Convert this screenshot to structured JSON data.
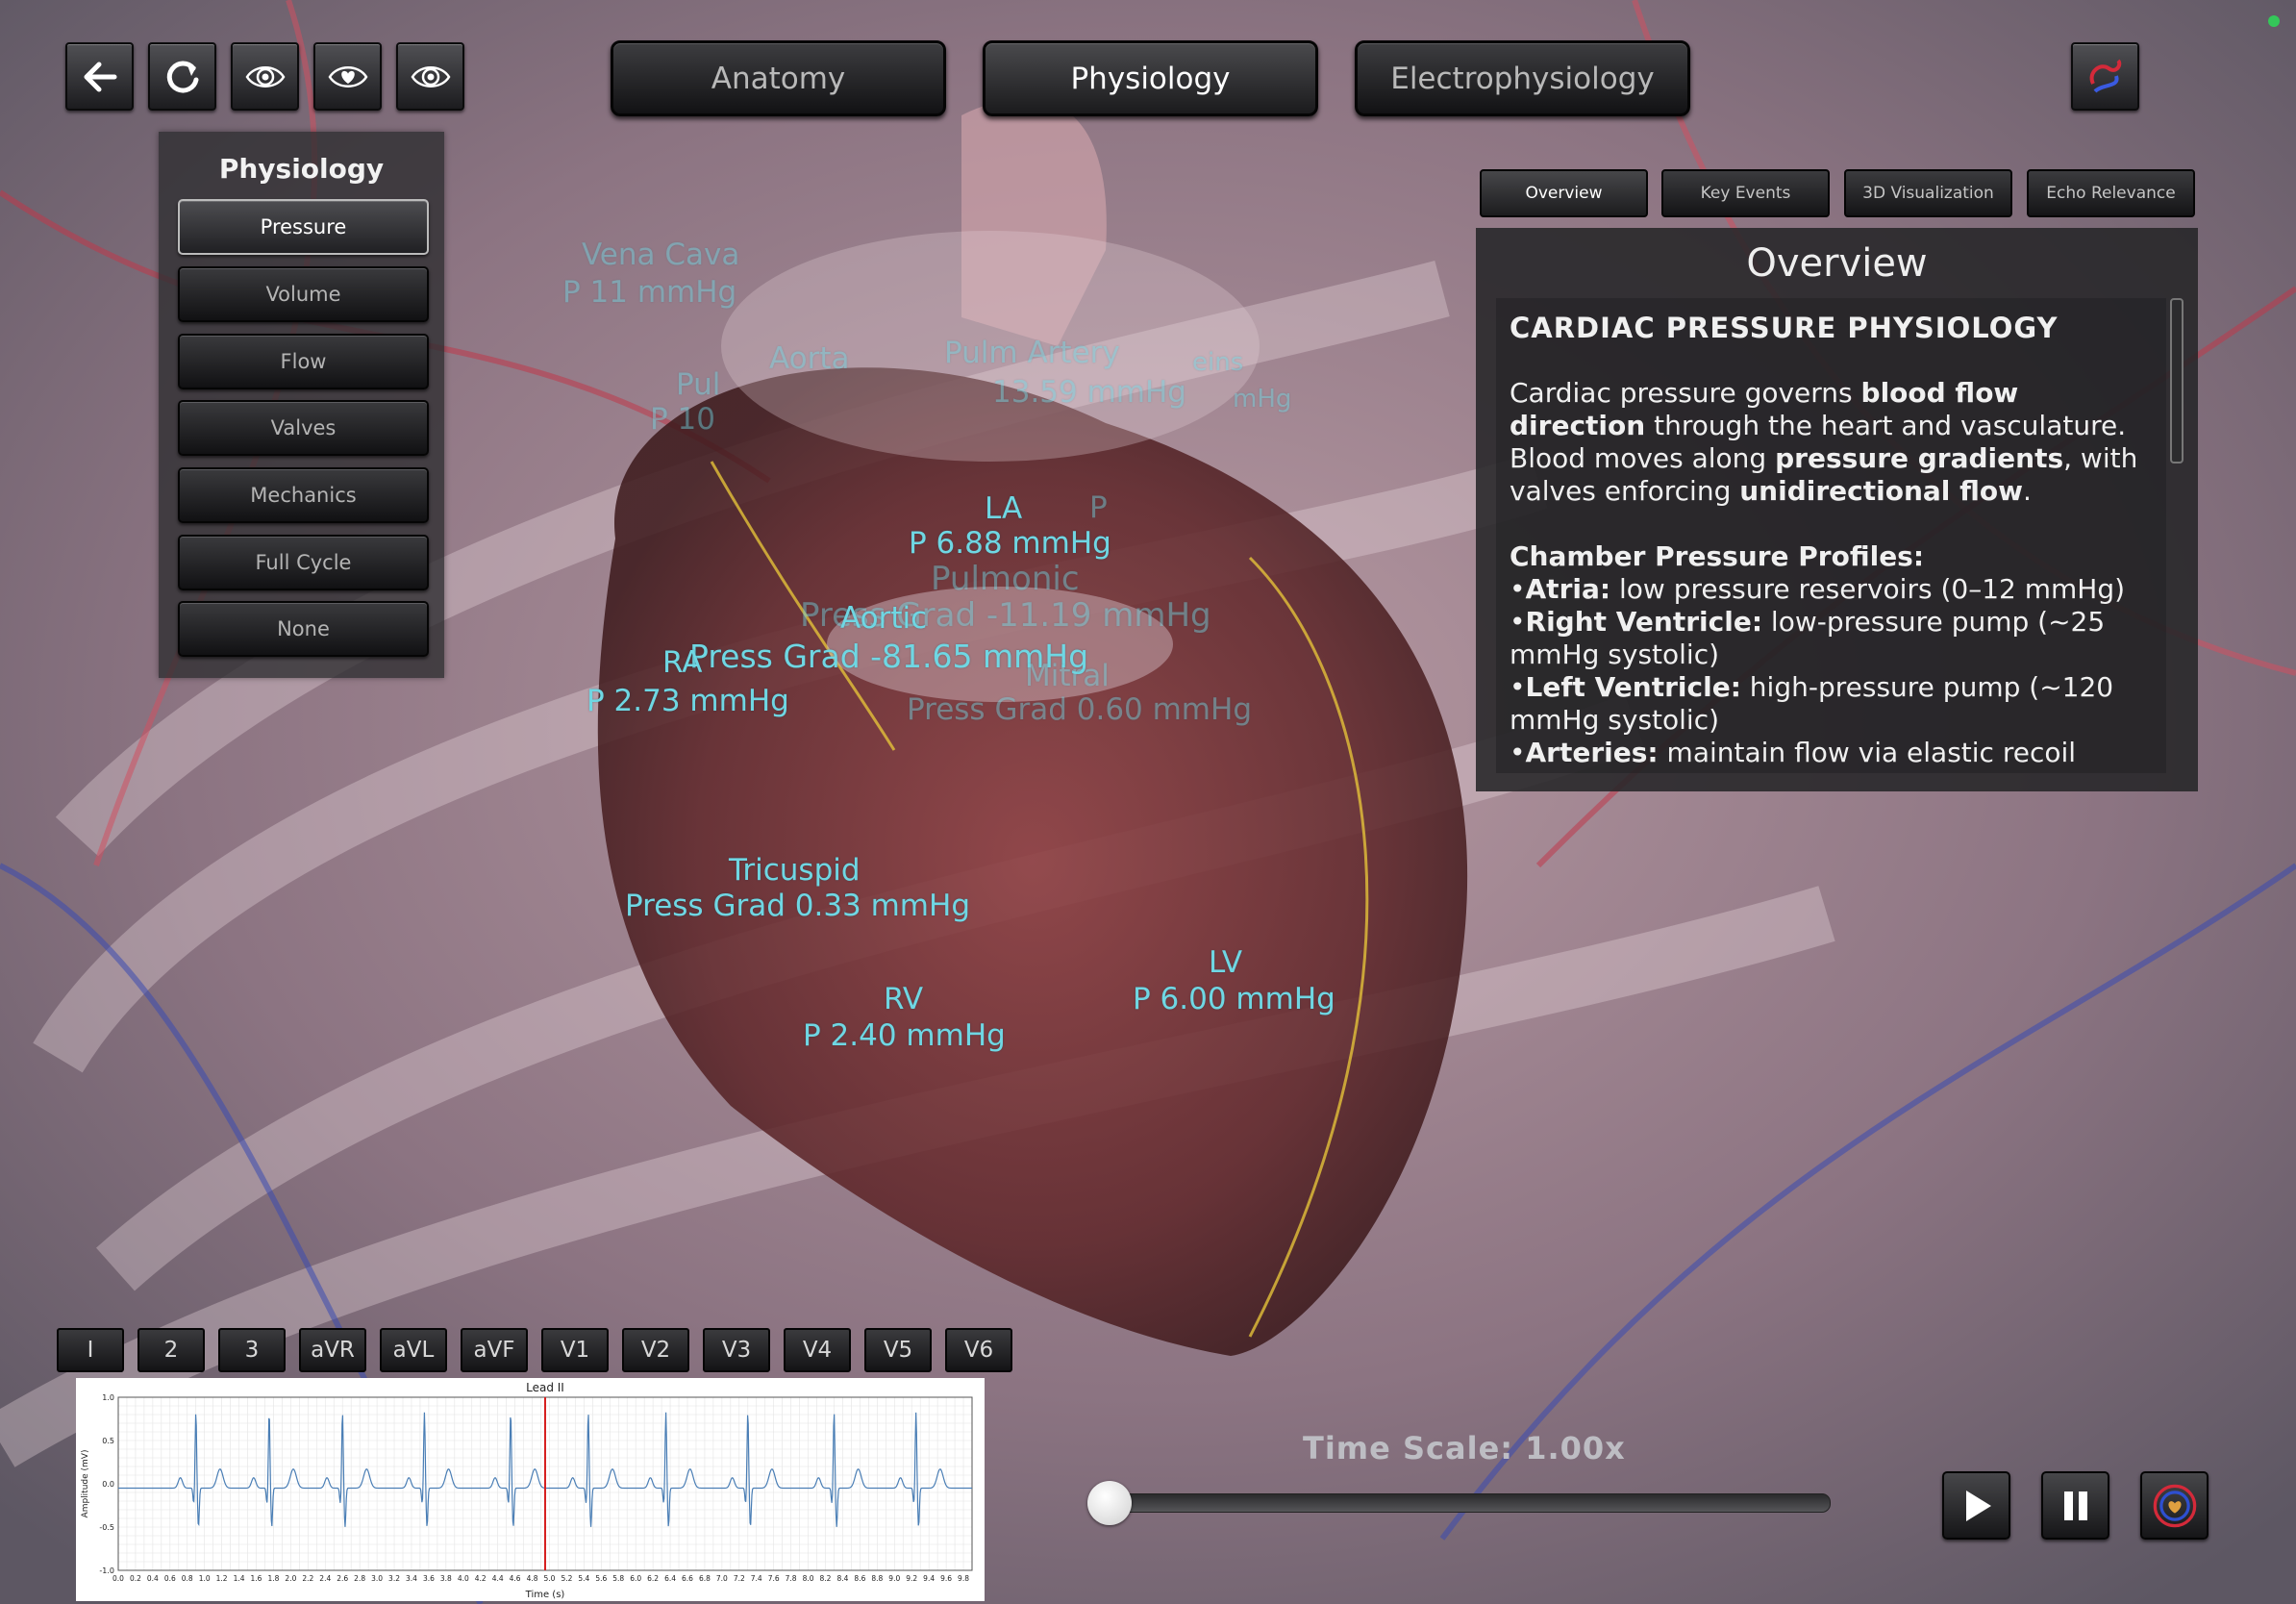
{
  "toolbar": {
    "icons": [
      "back-arrow-icon",
      "reload-icon",
      "eye-icon",
      "eye-heart-icon",
      "eye-icon"
    ]
  },
  "main_tabs": [
    {
      "label": "Anatomy",
      "active": false
    },
    {
      "label": "Physiology",
      "active": true
    },
    {
      "label": "Electrophysiology",
      "active": false
    }
  ],
  "sidebar": {
    "title": "Physiology",
    "items": [
      {
        "label": "Pressure",
        "active": true
      },
      {
        "label": "Volume",
        "active": false
      },
      {
        "label": "Flow",
        "active": false
      },
      {
        "label": "Valves",
        "active": false
      },
      {
        "label": "Mechanics",
        "active": false
      },
      {
        "label": "Full Cycle",
        "active": false
      },
      {
        "label": "None",
        "active": false
      }
    ]
  },
  "sub_tabs": [
    {
      "label": "Overview",
      "active": true
    },
    {
      "label": "Key Events",
      "active": false
    },
    {
      "label": "3D Visualization",
      "active": false
    },
    {
      "label": "Echo Relevance",
      "active": false
    }
  ],
  "overview": {
    "title": "Overview",
    "heading": "CARDIAC PRESSURE PHYSIOLOGY",
    "para": {
      "t1": "Cardiac pressure governs ",
      "b1": "blood flow direction",
      "t2": " through the heart and vasculature. Blood moves along ",
      "b2": "pressure gradients",
      "t3": ", with valves enforcing ",
      "b3": "unidirectional flow",
      "t4": "."
    },
    "profiles_title": "Chamber Pressure Profiles:",
    "profiles": [
      {
        "term": "Atria:",
        "text": " low pressure reservoirs (0–12 mmHg)"
      },
      {
        "term": "Right Ventricle:",
        "text": " low-pressure pump (~25 mmHg systolic)"
      },
      {
        "term": "Left Ventricle:",
        "text": " high-pressure pump (~120 mmHg systolic)"
      },
      {
        "term": "Arteries:",
        "text": " maintain flow via elastic recoil"
      }
    ],
    "bullet": "•"
  },
  "leads": [
    "I",
    "2",
    "3",
    "aVR",
    "aVL",
    "aVF",
    "V1",
    "V2",
    "V3",
    "V4",
    "V5",
    "V6"
  ],
  "ecg": {
    "title": "Lead II",
    "ylabel": "Amplitude (mV)",
    "xlabel": "Time (s)",
    "y_ticks": [
      "1.0",
      "0.5",
      "0.0",
      "-0.5",
      "-1.0"
    ],
    "x_ticks": [
      "0.0",
      "0.2",
      "0.4",
      "0.6",
      "0.8",
      "1.0",
      "1.2",
      "1.4",
      "1.6",
      "1.8",
      "2.0",
      "2.2",
      "2.4",
      "2.6",
      "2.8",
      "3.0",
      "3.2",
      "3.4",
      "3.6",
      "3.8",
      "4.0",
      "4.2",
      "4.4",
      "4.6",
      "4.8",
      "5.0",
      "5.2",
      "5.4",
      "5.6",
      "5.8",
      "6.0",
      "6.2",
      "6.4",
      "6.6",
      "6.8",
      "7.0",
      "7.2",
      "7.4",
      "7.6",
      "7.8",
      "8.0",
      "8.2",
      "8.4",
      "8.6",
      "8.8",
      "9.0",
      "9.2",
      "9.4",
      "9.6",
      "9.8"
    ],
    "xlim": [
      0,
      9.9
    ],
    "ylim": [
      -1.0,
      1.0
    ],
    "cursor_time": 4.95,
    "beat_times": [
      0.9,
      1.75,
      2.6,
      3.55,
      4.55,
      5.45,
      6.35,
      7.3,
      8.3,
      9.25
    ],
    "line_color": "#4a7eb5",
    "cursor_color": "#d62020"
  },
  "time_scale": {
    "label": "Time Scale: 1.00x",
    "value": 1.0,
    "min": 1.0,
    "max": 5.0
  },
  "controls": [
    "play-icon",
    "pause-icon",
    "heart-logo-icon"
  ],
  "labels": {
    "vena_cava": "Vena Cava",
    "vena_cava_p": "P 11 mmHg",
    "aorta": "Aorta",
    "pulm": "Pul",
    "pulm_p": "P 10",
    "pulm_artery": "Pulm Artery",
    "pulm_artery_p": "13.59 mmHg",
    "veins": "eins",
    "veins_p": "mHg",
    "p_mmhg": "P",
    "la": "LA",
    "la_p": "P 6.88 mmHg",
    "pulmonic": "Pulmonic",
    "pulmonic_grad": "Press Grad -11.19 mmHg",
    "aortic": "Aortic",
    "aortic_grad": "Press Grad -81.65 mmHg",
    "ra": "RA",
    "ra_p": "P 2.73 mmHg",
    "mitral": "Mitral",
    "mitral_grad": "Press Grad 0.60 mmHg",
    "tricuspid": "Tricuspid",
    "tricuspid_grad": "Press Grad 0.33 mmHg",
    "lv": "LV",
    "lv_p": "P 6.00 mmHg",
    "rv": "RV",
    "rv_p": "P 2.40 mmHg"
  },
  "colors": {
    "label_cyan": "#6fd7e3",
    "panel_bg": "#2d2d30",
    "status_dot": "#34c759"
  }
}
